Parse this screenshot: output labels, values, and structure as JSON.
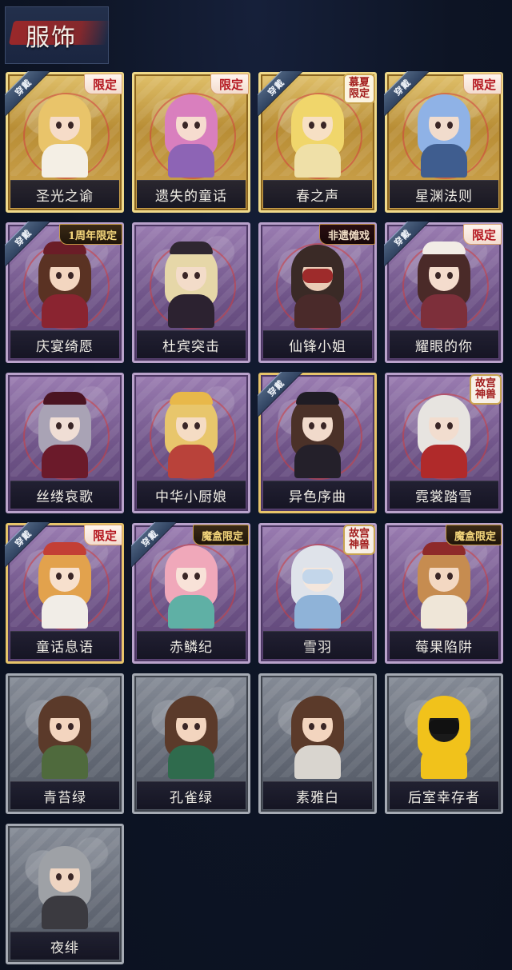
{
  "page": {
    "title": "服饰"
  },
  "colors": {
    "background": "#0d1424",
    "header_brush": "#a02828",
    "label_text": "#f1eee6",
    "limited_red": "#b3141d",
    "gold_frame": "#d4ae54",
    "purple_frame": "#7c5f96",
    "gray_frame": "#6a707c"
  },
  "equipped_label": "穿戴",
  "costumes": [
    {
      "name": "圣光之谕",
      "tier": "gold",
      "equipped": true,
      "tag": "限定",
      "tag_style": "red",
      "icon": "character-portrait-blonde-icon"
    },
    {
      "name": "遗失的童话",
      "tier": "gold",
      "equipped": false,
      "tag": "限定",
      "tag_style": "red",
      "icon": "character-portrait-pink-hair-icon"
    },
    {
      "name": "春之声",
      "tier": "gold",
      "equipped": true,
      "tag": "慕夏限定",
      "tag_style": "stamp",
      "icon": "character-portrait-golden-hair-icon"
    },
    {
      "name": "星渊法则",
      "tier": "gold",
      "equipped": true,
      "tag": "限定",
      "tag_style": "red",
      "icon": "character-portrait-blue-hair-icon"
    },
    {
      "name": "庆宴绮愿",
      "tier": "purple",
      "equipped": true,
      "tag": "1周年限定",
      "tag_style": "gold",
      "icon": "character-portrait-cake-icon"
    },
    {
      "name": "杜宾突击",
      "tier": "purple",
      "equipped": false,
      "tag": "",
      "tag_style": "",
      "icon": "character-portrait-cap-icon"
    },
    {
      "name": "仙锋小姐",
      "tier": "purple",
      "equipped": false,
      "tag": "非遗傩戏",
      "tag_style": "dark-red",
      "icon": "character-portrait-masked-icon"
    },
    {
      "name": "耀眼的你",
      "tier": "purple",
      "equipped": true,
      "tag": "限定",
      "tag_style": "red",
      "icon": "character-portrait-cowboy-hat-icon"
    },
    {
      "name": "丝缕哀歌",
      "tier": "purple",
      "equipped": false,
      "tag": "",
      "tag_style": "",
      "icon": "character-portrait-gray-hair-icon"
    },
    {
      "name": "中华小厨娘",
      "tier": "purple",
      "equipped": false,
      "tag": "",
      "tag_style": "",
      "icon": "character-portrait-chef-icon"
    },
    {
      "name": "异色序曲",
      "tier": "purple",
      "equipped": true,
      "tag": "",
      "tag_style": "",
      "gold_edge": true,
      "icon": "character-portrait-top-hat-icon"
    },
    {
      "name": "霓裳踏雪",
      "tier": "purple",
      "equipped": false,
      "tag": "故宫神兽",
      "tag_style": "stamp",
      "icon": "character-portrait-white-hair-icon"
    },
    {
      "name": "童话息语",
      "tier": "purple",
      "equipped": true,
      "tag": "限定",
      "tag_style": "red",
      "gold_edge": true,
      "icon": "character-portrait-orange-hair-icon"
    },
    {
      "name": "赤鳞纪",
      "tier": "purple",
      "equipped": true,
      "tag": "魔盒限定",
      "tag_style": "gold",
      "icon": "character-portrait-pink-dragon-icon"
    },
    {
      "name": "雪羽",
      "tier": "purple",
      "equipped": false,
      "tag": "故宫神兽",
      "tag_style": "stamp",
      "icon": "character-portrait-silver-hair-icon"
    },
    {
      "name": "莓果陷阱",
      "tier": "purple",
      "equipped": false,
      "tag": "魔盒限定",
      "tag_style": "gold",
      "icon": "character-portrait-berry-hat-icon"
    },
    {
      "name": "青苔绿",
      "tier": "gray",
      "equipped": false,
      "tag": "",
      "tag_style": "",
      "icon": "character-portrait-brown-hair-icon"
    },
    {
      "name": "孔雀绿",
      "tier": "gray",
      "equipped": false,
      "tag": "",
      "tag_style": "",
      "icon": "character-portrait-brown-hair-icon"
    },
    {
      "name": "素雅白",
      "tier": "gray",
      "equipped": false,
      "tag": "",
      "tag_style": "",
      "icon": "character-portrait-brown-hair-icon"
    },
    {
      "name": "后室幸存者",
      "tier": "gray",
      "equipped": false,
      "tag": "",
      "tag_style": "",
      "icon": "character-portrait-hazmat-icon"
    },
    {
      "name": "夜绯",
      "tier": "gray",
      "equipped": false,
      "tag": "",
      "tag_style": "",
      "icon": "character-portrait-gray-suit-icon"
    }
  ]
}
